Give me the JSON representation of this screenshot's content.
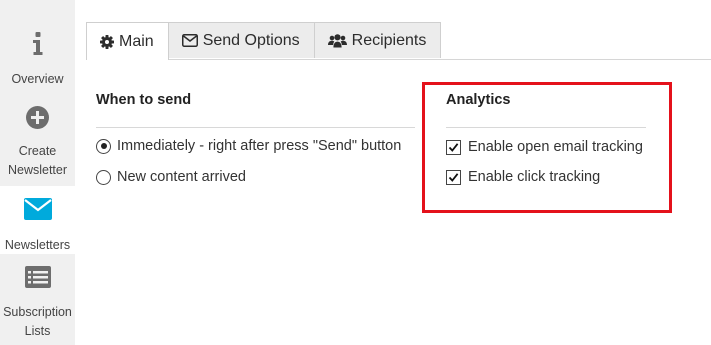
{
  "sidebar": {
    "items": [
      {
        "label": "Overview",
        "icon": "info-icon"
      },
      {
        "label": "Create Newsletter",
        "icon": "plus-circle-icon"
      },
      {
        "label": "Newsletters",
        "icon": "envelope-icon",
        "active": true
      },
      {
        "label": "Subscription Lists",
        "icon": "list-card-icon"
      }
    ]
  },
  "tabs": [
    {
      "label": "Main",
      "icon": "gear-icon",
      "active": true
    },
    {
      "label": "Send Options",
      "icon": "envelope-outline-icon"
    },
    {
      "label": "Recipients",
      "icon": "users-icon"
    }
  ],
  "when_to_send": {
    "title": "When to send",
    "options": [
      {
        "label": "Immediately - right after press \"Send\" button",
        "checked": true
      },
      {
        "label": "New content arrived",
        "checked": false
      }
    ]
  },
  "analytics": {
    "title": "Analytics",
    "options": [
      {
        "label": "Enable open email tracking",
        "checked": true
      },
      {
        "label": "Enable click tracking",
        "checked": true
      }
    ]
  },
  "colors": {
    "accent": "#00aadc",
    "highlight": "#e4111b",
    "sidebar_bg": "#f0f0f0",
    "icon_gray": "#6d6d6d"
  }
}
